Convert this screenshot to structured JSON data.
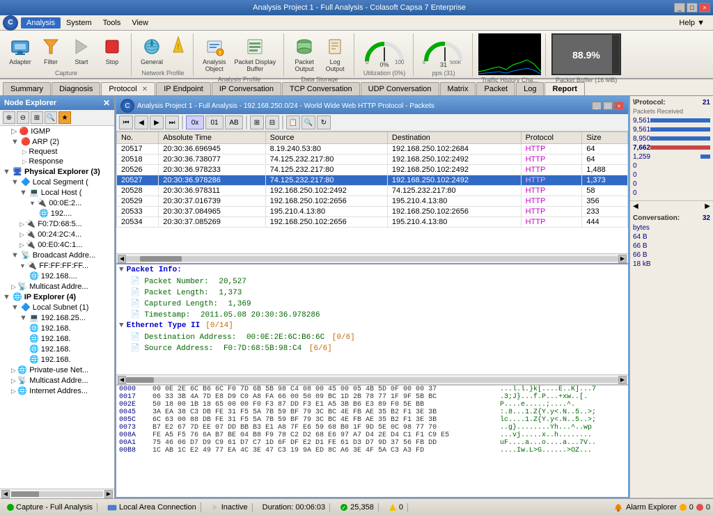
{
  "titleBar": {
    "title": "Analysis Project 1 - Full Analysis - Colasoft Capsa 7 Enterprise",
    "buttons": [
      "_",
      "□",
      "×"
    ]
  },
  "menuBar": {
    "items": [
      "Analysis",
      "System",
      "Tools",
      "View"
    ],
    "activeItem": "Analysis",
    "help": "Help ▼"
  },
  "toolbar": {
    "captureGroup": {
      "label": "Capture",
      "buttons": [
        {
          "id": "adapter",
          "label": "Adapter"
        },
        {
          "id": "filter",
          "label": "Filter"
        },
        {
          "id": "start",
          "label": "Start"
        },
        {
          "id": "stop",
          "label": "Stop"
        }
      ]
    },
    "networkProfileGroup": {
      "label": "Network Profile",
      "buttons": [
        {
          "id": "general",
          "label": "General"
        }
      ]
    },
    "analysisProfileGroup": {
      "label": "Analysis Profile",
      "buttons": [
        {
          "id": "analysis-object",
          "label": "Analysis\nObject"
        },
        {
          "id": "packet-display-buffer",
          "label": "Packet Display\nBuffer"
        }
      ]
    },
    "dataStorageGroup": {
      "label": "Data Storage",
      "buttons": [
        {
          "id": "packet-output",
          "label": "Packet\nOutput"
        },
        {
          "id": "log-output",
          "label": "Log\nOutput"
        }
      ]
    },
    "utilizationWidget": {
      "label": "Utilization (0%)",
      "value": "0%"
    },
    "ppsWidget": {
      "label": "pps (31)",
      "value": "31"
    },
    "trafficHistory": {
      "label": "Traffic History Cha..."
    },
    "packetBuffer": {
      "label": "Packet Buffer (16 MB)",
      "value": "88.9%"
    }
  },
  "tabs": [
    {
      "id": "summary",
      "label": "Summary",
      "closable": false
    },
    {
      "id": "diagnosis",
      "label": "Diagnosis",
      "closable": false
    },
    {
      "id": "protocol",
      "label": "Protocol",
      "closable": true,
      "active": false
    },
    {
      "id": "ip-endpoint",
      "label": "IP Endpoint",
      "closable": false
    },
    {
      "id": "ip-conversation",
      "label": "IP Conversation",
      "closable": false
    },
    {
      "id": "tcp-conversation",
      "label": "TCP Conversation",
      "closable": false
    },
    {
      "id": "udp-conversation",
      "label": "UDP Conversation",
      "closable": false
    },
    {
      "id": "matrix",
      "label": "Matrix",
      "closable": false
    },
    {
      "id": "packet",
      "label": "Packet",
      "closable": false
    },
    {
      "id": "log",
      "label": "Log",
      "closable": false
    },
    {
      "id": "report",
      "label": "Report",
      "closable": false
    }
  ],
  "nodeExplorer": {
    "title": "Node Explorer",
    "treeItems": [
      {
        "level": 0,
        "icon": "igmp",
        "label": "IGMP",
        "expanded": false
      },
      {
        "level": 0,
        "icon": "arp",
        "label": "ARP (2)",
        "expanded": true
      },
      {
        "level": 1,
        "icon": "request",
        "label": "Request"
      },
      {
        "level": 1,
        "icon": "response",
        "label": "Response"
      },
      {
        "level": 0,
        "icon": "physical",
        "label": "Physical Explorer (3)",
        "expanded": true,
        "bold": true
      },
      {
        "level": 1,
        "icon": "subnet",
        "label": "Local Segment (",
        "expanded": true
      },
      {
        "level": 2,
        "icon": "host",
        "label": "Local Host ("
      },
      {
        "level": 3,
        "icon": "mac",
        "label": "00:0E:2..."
      },
      {
        "level": 4,
        "icon": "ip",
        "label": "192...."
      },
      {
        "level": 2,
        "icon": "mac2",
        "label": "F0:7D:68:5..."
      },
      {
        "level": 2,
        "icon": "mac3",
        "label": "00:24:2C:4..."
      },
      {
        "level": 2,
        "icon": "mac4",
        "label": "00:E0:4C:1..."
      },
      {
        "level": 1,
        "icon": "broadcast",
        "label": "Broadcast Addre..."
      },
      {
        "level": 2,
        "icon": "mac5",
        "label": "FF:FF:FF:FF..."
      },
      {
        "level": 3,
        "icon": "ip2",
        "label": "192.168...."
      },
      {
        "level": 1,
        "icon": "multicast",
        "label": "Multicast Addre..."
      },
      {
        "level": 0,
        "icon": "ipexplorer",
        "label": "IP Explorer (4)",
        "expanded": true,
        "bold": true
      },
      {
        "level": 1,
        "icon": "localsubnet",
        "label": "Local Subnet (1)",
        "expanded": true
      },
      {
        "level": 2,
        "icon": "ip3",
        "label": "192.168.25..."
      },
      {
        "level": 3,
        "icon": "ip4",
        "label": "192.168."
      },
      {
        "level": 3,
        "icon": "ip5",
        "label": "192.168."
      },
      {
        "level": 3,
        "icon": "ip6",
        "label": "192.168."
      },
      {
        "level": 3,
        "icon": "ip7",
        "label": "192.168."
      },
      {
        "level": 1,
        "icon": "private",
        "label": "Private-use Net..."
      },
      {
        "level": 1,
        "icon": "multicast2",
        "label": "Multicast Addre..."
      },
      {
        "level": 1,
        "icon": "internet",
        "label": "Internet Addres..."
      }
    ]
  },
  "packetWindow": {
    "title": "Analysis Project 1 - Full Analysis - 192.168.250.0/24 - World Wide Web HTTP Protocol - Packets",
    "tableHeaders": [
      "No.",
      "Absolute Time",
      "Source",
      "Destination",
      "Protocol",
      "Size"
    ],
    "rows": [
      {
        "no": "20517",
        "time": "20:30:36.696945",
        "source": "8.19.240.53:80",
        "dest": "192.168.250.102:2684",
        "protocol": "HTTP",
        "size": "64",
        "selected": false
      },
      {
        "no": "20518",
        "time": "20:30:36.738077",
        "source": "74.125.232.217:80",
        "dest": "192.168.250.102:2492",
        "protocol": "HTTP",
        "size": "64",
        "selected": false
      },
      {
        "no": "20526",
        "time": "20:30:36.978233",
        "source": "74.125.232.217:80",
        "dest": "192.168.250.102:2492",
        "protocol": "HTTP",
        "size": "1,488",
        "selected": false
      },
      {
        "no": "20527",
        "time": "20:30:36.978286",
        "source": "74.125.232.217:80",
        "dest": "192.168.250.102:2492",
        "protocol": "HTTP",
        "size": "1,373",
        "selected": true
      },
      {
        "no": "20528",
        "time": "20:30:36.978311",
        "source": "192.168.250.102:2492",
        "dest": "74.125.232.217:80",
        "protocol": "HTTP",
        "size": "58",
        "selected": false
      },
      {
        "no": "20529",
        "time": "20:30:37.016739",
        "source": "192.168.250.102:2656",
        "dest": "195.210.4.13:80",
        "protocol": "HTTP",
        "size": "356",
        "selected": false
      },
      {
        "no": "20533",
        "time": "20:30:37.084965",
        "source": "195.210.4.13:80",
        "dest": "192.168.250.102:2656",
        "protocol": "HTTP",
        "size": "233",
        "selected": false
      },
      {
        "no": "20534",
        "time": "20:30:37.085269",
        "source": "192.168.250.102:2656",
        "dest": "195.210.4.13:80",
        "protocol": "HTTP",
        "size": "444",
        "selected": false
      }
    ],
    "detail": {
      "packetInfo": "Packet Info:",
      "fields": [
        {
          "label": "Packet Number:",
          "value": "20,527"
        },
        {
          "label": "Packet Length:",
          "value": "1,373"
        },
        {
          "label": "Captured Length:",
          "value": "1,369"
        },
        {
          "label": "Timestamp:",
          "value": "2011.05.08 20:30:36.978286"
        }
      ],
      "ethernetType": "Ethernet Type II",
      "ethernetTypeValue": "[0/14]",
      "destAddress": "Destination Address:",
      "destAddressValue": "00:0E:2E:6C:B6:6C",
      "destAddressExtra": "[0/6]",
      "srcAddress": "Source Address:",
      "srcAddressValue": "F0:7D:68:5B:98:C4",
      "srcAddressExtra": "[6/6]"
    },
    "hexRows": [
      {
        "addr": "0000",
        "bytes": "00 0E 2E 6C B6 6C F0 7D 6B 5B 98 C4 08 00 45 00 05 4B 5D 0F 00 00 37",
        "ascii": "...l.l.}k[....E..K]...7"
      },
      {
        "addr": "0017",
        "bytes": "06 33 3B 4A 7D E8 D9 C0 A8 FA 66 00 50 09 BC 1D 2B 78 77 1F 9F 5B BC",
        "ascii": ".3;J}...f.P...+xw..[."
      },
      {
        "addr": "002E",
        "bytes": "50 18 00 1B 18 65 00 00 F0 F3 87 DD F3 E1 A5 3B B6 E3 89 F0 5E BB",
        "ascii": "P....e.....;....^."
      },
      {
        "addr": "0045",
        "bytes": "3A EA 38 C3 DB FE 31 F5 5A 7B 59 BF 79 3C BC 4E FB AE 35 B2 F1 3E 3B",
        "ascii": ":.8...1.Z{Y.y<.N..5..>;"
      },
      {
        "addr": "005C",
        "bytes": "6C 63 00 88 DB FE 31 F5 5A 7B 59 BF 79 3C BC 4E FB AE 35 B2 F1 3E 3B",
        "ascii": "lc....1.Z{Y.y<.N..5..>;"
      },
      {
        "addr": "0073",
        "bytes": "B7 E2 67 7D EE 07 DD BB B3 E1 A8 7F E6 59 68 B0 1F 9D 5E 0C 98 77 70",
        "ascii": "..g}........Yh...^..wp"
      },
      {
        "addr": "008A",
        "bytes": "FE A5 F5 76 6A B7 BE 04 B8 F9 78 C2 D2 68 E6 97 A7 D4 2E D4 C1 F1 C9 E5",
        "ascii": "...vj.....x..h........"
      },
      {
        "addr": "00A1",
        "bytes": "75 46 06 D7 D9 C9 61 D7 C7 1D 6F DF E2 D1 FE 61 D3 D7 9D 37 56 FB DD",
        "ascii": "uF....a...o....a...7V.."
      },
      {
        "addr": "00B8",
        "bytes": "1C AB 1C E2 49 77 EA 4C 3E 47 C3 19 9A ED 8C A6 3E 4F 5A C3 A3 FD",
        "ascii": "....Iw.L>G......>OZ..."
      }
    ]
  },
  "rightPanel": {
    "protocolHeader": "\\Protocol:",
    "protocolCount": "21",
    "packetsReceived": "Packets Received",
    "rows": [
      {
        "label": "",
        "value": "9,561",
        "barWidth": 100
      },
      {
        "label": "",
        "value": "9,561",
        "barWidth": 100
      },
      {
        "label": "",
        "value": "8,950",
        "barWidth": 94
      },
      {
        "label": "",
        "value": "7,662",
        "barWidth": 80,
        "highlight": true
      },
      {
        "label": "",
        "value": "1,259",
        "barWidth": 13
      },
      {
        "label": "",
        "value": "0",
        "barWidth": 0
      },
      {
        "label": "",
        "value": "0",
        "barWidth": 0
      },
      {
        "label": "",
        "value": "0",
        "barWidth": 0
      },
      {
        "label": "",
        "value": "0",
        "barWidth": 0
      }
    ],
    "conversation": "Conversation:",
    "convCount": "32",
    "convRows": [
      {
        "label": "bytes",
        "value": ""
      },
      {
        "label": "64 B",
        "value": ""
      },
      {
        "label": "66 B",
        "value": ""
      },
      {
        "label": "66 B",
        "value": ""
      },
      {
        "label": "18 kB",
        "value": ""
      }
    ]
  },
  "statusBar": {
    "captureLabel": "Capture - Full Analysis",
    "connection": "Local Area Connection",
    "status": "Inactive",
    "duration": "Duration: 00:06:03",
    "packets": "25,358",
    "errors": "0",
    "alarmExplorer": "Alarm Explorer",
    "alarmCount1": "0",
    "alarmCount2": "0"
  }
}
